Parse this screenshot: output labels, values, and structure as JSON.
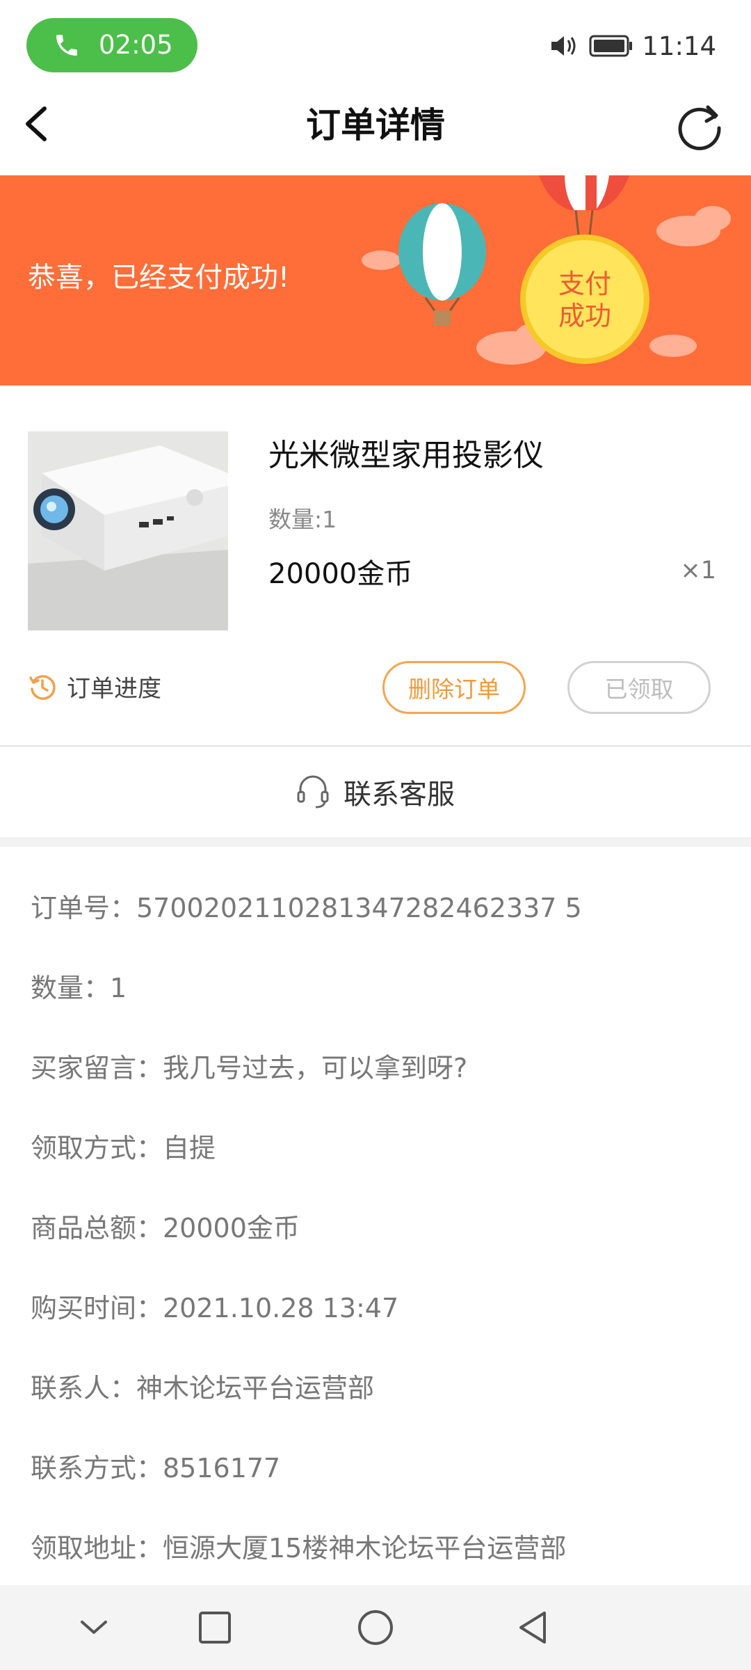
{
  "status_bar": {
    "call_time": "02:05",
    "clock": "11:14"
  },
  "header": {
    "title": "订单详情"
  },
  "banner": {
    "message": "恭喜，已经支付成功!",
    "badge_line1": "支付",
    "badge_line2": "成功"
  },
  "product": {
    "name": "光米微型家用投影仪",
    "quantity_label": "数量:1",
    "price": "20000金币",
    "multiplier": "×1"
  },
  "actions": {
    "progress_label": "订单进度",
    "delete_label": "删除订单",
    "claimed_label": "已领取"
  },
  "service": {
    "label": "联系客服"
  },
  "order_info": [
    "订单号：5700202110281347282462337 5",
    "数量：1",
    "买家留言：我几号过去，可以拿到呀?",
    "领取方式：自提",
    "商品总额：20000金币",
    "购买时间：2021.10.28 13:47",
    "联系人：神木论坛平台运营部",
    "联系方式：8516177",
    "领取地址：恒源大厦15楼神木论坛平台运营部"
  ],
  "colors": {
    "accent_orange": "#ff6d38",
    "call_green": "#4cbe4a",
    "button_orange": "#f5a54d"
  }
}
